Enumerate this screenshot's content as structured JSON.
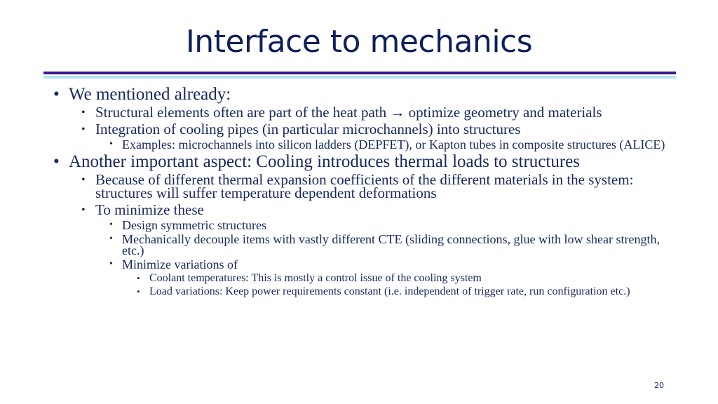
{
  "slide": {
    "title": "Interface to mechanics",
    "page_number": "20",
    "bullet_glyph": "•",
    "items": [
      {
        "level": 1,
        "text": "We mentioned already:"
      },
      {
        "level": 2,
        "text": "Structural elements often are part of the heat path → optimize geometry and materials"
      },
      {
        "level": 2,
        "text": "Integration of cooling pipes (in particular microchannels) into structures"
      },
      {
        "level": 3,
        "text": "Examples: microchannels into silicon ladders (DEPFET), or Kapton tubes in composite structures (ALICE)"
      },
      {
        "level": 1,
        "text": "Another important aspect: Cooling introduces thermal loads to structures"
      },
      {
        "level": 2,
        "text": "Because of different thermal expansion coefficients of the different materials in the system: structures will suffer temperature dependent deformations"
      },
      {
        "level": 2,
        "text": "To minimize these"
      },
      {
        "level": 3,
        "text": "Design symmetric structures"
      },
      {
        "level": 3,
        "text": "Mechanically decouple items with vastly different CTE (sliding connections, glue with low shear strength, etc.)"
      },
      {
        "level": 3,
        "text": "Minimize variations of"
      },
      {
        "level": 4,
        "text": "Coolant temperatures: This is mostly a control issue of the cooling system"
      },
      {
        "level": 4,
        "text": "Load variations: Keep power requirements constant (i.e. independent of trigger rate, run configuration etc.)"
      }
    ]
  },
  "colors": {
    "title": "#0d1f5c",
    "text": "#14285e",
    "rule_dark": "#3a1a8c",
    "rule_light": "#b4e4f2"
  }
}
